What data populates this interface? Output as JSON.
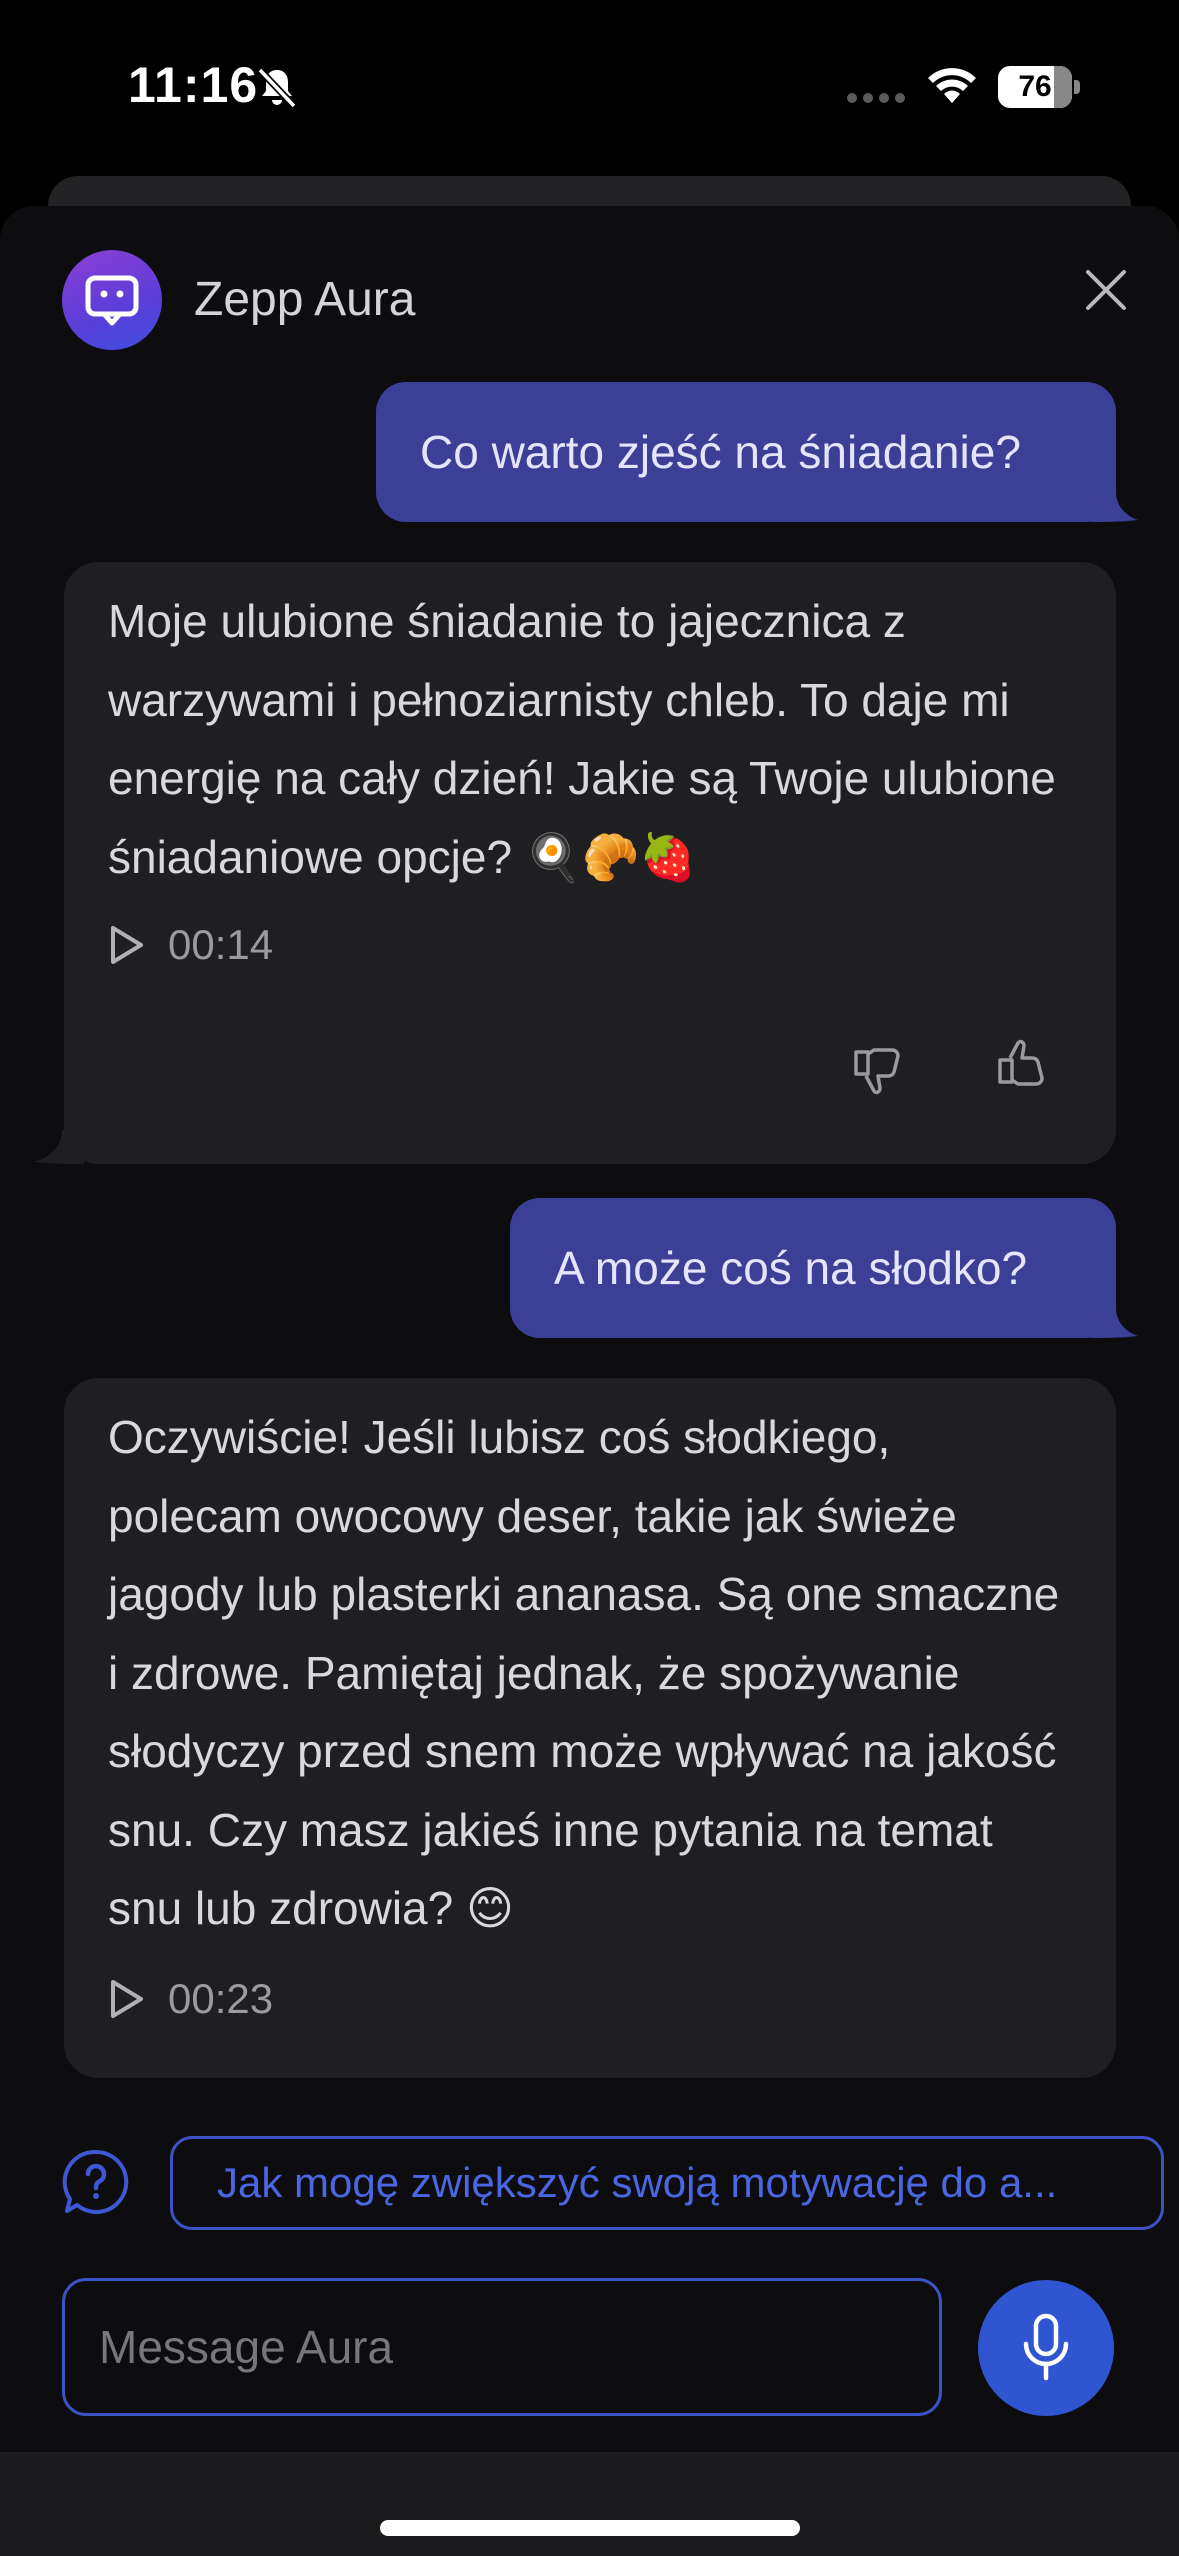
{
  "status_bar": {
    "time": "11:16",
    "battery": "76",
    "icons": [
      "bell-slash-icon",
      "cellular-signal-icon",
      "wifi-icon",
      "battery-icon"
    ]
  },
  "header": {
    "app_name": "Zepp Aura",
    "avatar_icon": "chat-bubble-icon",
    "close_icon": "close-icon"
  },
  "messages": [
    {
      "role": "user",
      "text": "Co warto zjeść na śniadanie?"
    },
    {
      "role": "assistant",
      "text": "Moje ulubione śniadanie to jajecznica z warzywami i pełnoziarnisty chleb. To daje mi energię na cały dzień! Jakie są Twoje ulubione śniadaniowe opcje? 🍳🥐🍓",
      "duration": "00:14"
    },
    {
      "role": "user",
      "text": "A może coś na słodko?"
    },
    {
      "role": "assistant",
      "text": "Oczywiście! Jeśli lubisz coś słodkiego, polecam owocowy deser, takie jak świeże jagody lub plasterki ananasa. Są one smaczne i zdrowe. Pamiętaj jednak, że spożywanie słodyczy przed snem może wpływać na jakość snu. Czy masz jakieś inne pytania na temat snu lub zdrowia? 😊",
      "duration": "00:23"
    }
  ],
  "suggestion": {
    "text": "Jak mogę zwiększyć swoją motywację do a...",
    "icon": "question-bubble-icon"
  },
  "composer": {
    "placeholder": "Message Aura",
    "mic_icon": "microphone-icon"
  },
  "colors": {
    "user_bubble": "#3c3f96",
    "bot_bubble": "#1f1f21",
    "accent": "#2f55d1",
    "background": "#0d0d0f"
  }
}
